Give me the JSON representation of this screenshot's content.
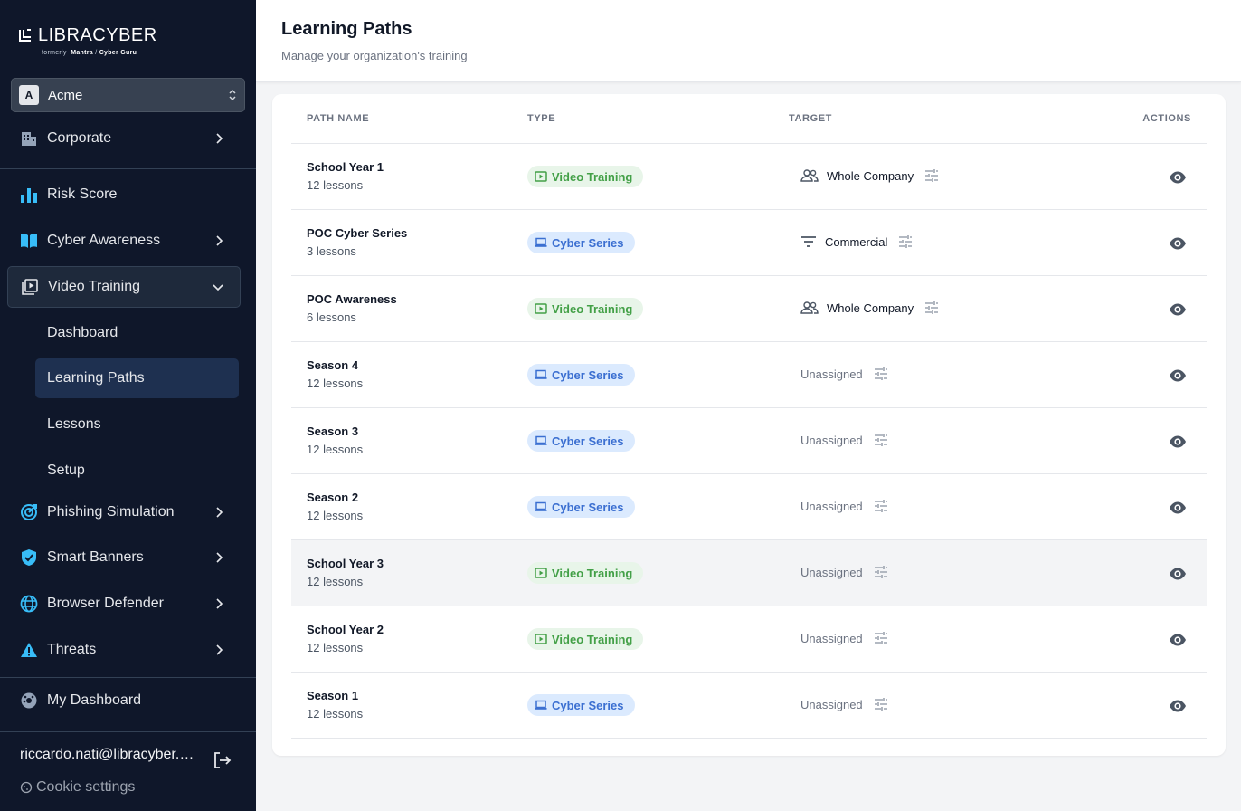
{
  "brand": {
    "name": "LIBRACYBER",
    "formerly": "formerly",
    "old_brand_1": "Mantra",
    "separator": "/",
    "old_brand_2": "Cyber Guru"
  },
  "org": {
    "initial": "A",
    "name": "Acme"
  },
  "nav": {
    "corporate": "Corporate",
    "risk_score": "Risk Score",
    "cyber_awareness": "Cyber Awareness",
    "video_training": "Video Training",
    "sub": {
      "dashboard": "Dashboard",
      "learning_paths": "Learning Paths",
      "lessons": "Lessons",
      "setup": "Setup"
    },
    "phishing": "Phishing Simulation",
    "smart_banners": "Smart Banners",
    "browser_defender": "Browser Defender",
    "threats": "Threats",
    "my_dashboard": "My Dashboard"
  },
  "footer": {
    "email": "riccardo.nati@libracyber.com",
    "cookie": "Cookie settings"
  },
  "header": {
    "title": "Learning Paths",
    "subtitle": "Manage your organization's training"
  },
  "table": {
    "columns": {
      "name": "PATH NAME",
      "type": "TYPE",
      "target": "TARGET",
      "actions": "ACTIONS"
    },
    "rows": [
      {
        "name": "School Year 1",
        "lessons": "12 lessons",
        "type": "Video Training",
        "target": "Whole Company"
      },
      {
        "name": "POC Cyber Series",
        "lessons": "3 lessons",
        "type": "Cyber Series",
        "target": "Commercial"
      },
      {
        "name": "POC Awareness",
        "lessons": "6 lessons",
        "type": "Video Training",
        "target": "Whole Company"
      },
      {
        "name": "Season 4",
        "lessons": "12 lessons",
        "type": "Cyber Series",
        "target": "Unassigned"
      },
      {
        "name": "Season 3",
        "lessons": "12 lessons",
        "type": "Cyber Series",
        "target": "Unassigned"
      },
      {
        "name": "Season 2",
        "lessons": "12 lessons",
        "type": "Cyber Series",
        "target": "Unassigned"
      },
      {
        "name": "School Year 3",
        "lessons": "12 lessons",
        "type": "Video Training",
        "target": "Unassigned"
      },
      {
        "name": "School Year 2",
        "lessons": "12 lessons",
        "type": "Video Training",
        "target": "Unassigned"
      },
      {
        "name": "Season 1",
        "lessons": "12 lessons",
        "type": "Cyber Series",
        "target": "Unassigned"
      }
    ]
  },
  "colors": {
    "sidebar_bg": "#0f172a",
    "accent_icon": "#38bdf8",
    "video_green": "#43a047",
    "cyber_blue": "#3b6fd1"
  }
}
